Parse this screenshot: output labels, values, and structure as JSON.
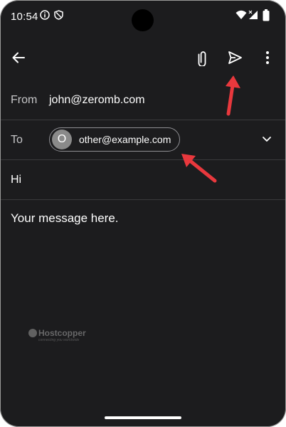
{
  "status_bar": {
    "time": "10:54",
    "icons": [
      "info-icon",
      "shield-icon",
      "wifi-icon",
      "signal-icon",
      "battery-icon"
    ]
  },
  "app_bar": {
    "icons": [
      "back-arrow-icon",
      "attach-icon",
      "send-icon",
      "more-vert-icon"
    ]
  },
  "compose": {
    "from_label": "From",
    "from_value": "john@zeromb.com",
    "to_label": "To",
    "to_chip": {
      "avatar_letter": "O",
      "email": "other@example.com"
    },
    "subject": "Hi",
    "body": "Your message here."
  },
  "watermark": {
    "name": "Hostcopper",
    "tagline": "connecting you worldwide"
  },
  "colors": {
    "background": "#1c1c1e",
    "divider": "#3a3a3c",
    "annotation_arrow": "#e8383d"
  }
}
